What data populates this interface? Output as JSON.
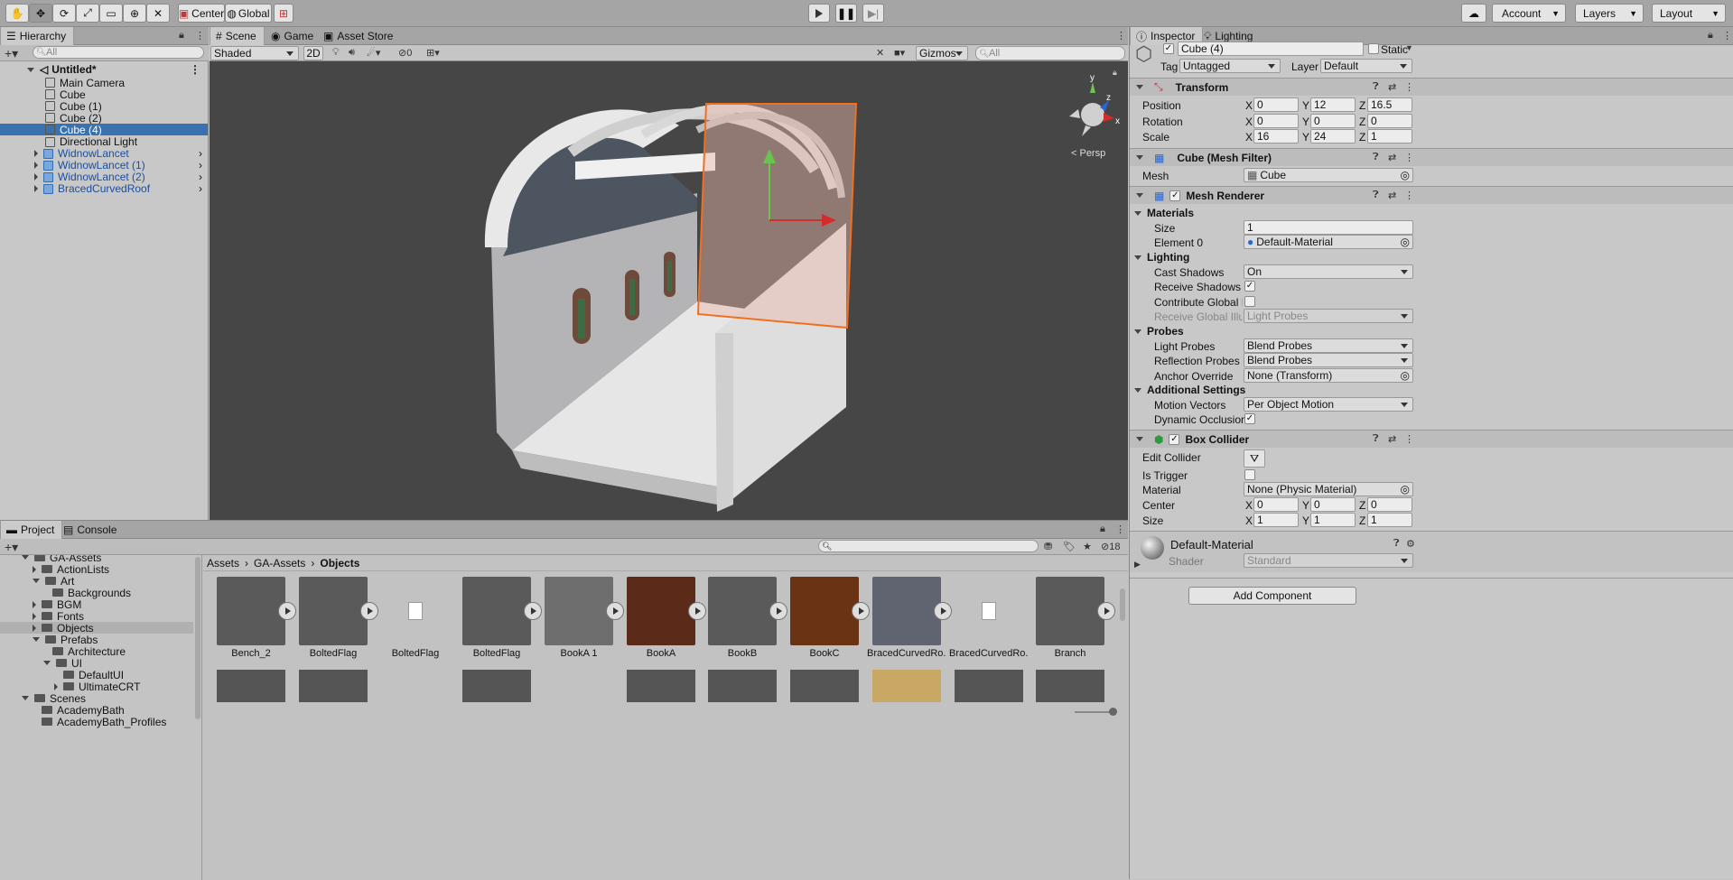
{
  "toolbar": {
    "pivot_label": "Center",
    "space_label": "Global",
    "account_label": "Account",
    "layers_label": "Layers",
    "layout_label": "Layout"
  },
  "hierarchy": {
    "tab_label": "Hierarchy",
    "search_placeholder": "All",
    "scene_name": "Untitled*",
    "items": [
      {
        "label": "Main Camera"
      },
      {
        "label": "Cube"
      },
      {
        "label": "Cube (1)"
      },
      {
        "label": "Cube (2)"
      },
      {
        "label": "Cube (4)"
      },
      {
        "label": "Directional Light"
      },
      {
        "label": "WidnowLancet"
      },
      {
        "label": "WidnowLancet (1)"
      },
      {
        "label": "WidnowLancet (2)"
      },
      {
        "label": "BracedCurvedRoof"
      }
    ]
  },
  "scene_view": {
    "tabs": [
      {
        "label": "Scene"
      },
      {
        "label": "Game"
      },
      {
        "label": "Asset Store"
      }
    ],
    "shading_mode": "Shaded",
    "mode_2d": "2D",
    "hidden_count": "0",
    "gizmos_label": "Gizmos",
    "search_placeholder": "All",
    "persp_label": "< Persp",
    "axis_y": "y",
    "axis_z": "z",
    "axis_x": "x"
  },
  "inspector": {
    "tabs": [
      {
        "label": "Inspector"
      },
      {
        "label": "Lighting"
      }
    ],
    "object_name": "Cube (4)",
    "static_label": "Static",
    "tag_label": "Tag",
    "tag_value": "Untagged",
    "layer_label": "Layer",
    "layer_value": "Default",
    "transform": {
      "title": "Transform",
      "position_label": "Position",
      "position": [
        "0",
        "12",
        "16.5"
      ],
      "rotation_label": "Rotation",
      "rotation": [
        "0",
        "0",
        "0"
      ],
      "scale_label": "Scale",
      "scale": [
        "16",
        "24",
        "1"
      ]
    },
    "mesh_filter": {
      "title": "Cube (Mesh Filter)",
      "mesh_label": "Mesh",
      "mesh_value": "Cube"
    },
    "mesh_renderer": {
      "title": "Mesh Renderer",
      "materials_label": "Materials",
      "size_label": "Size",
      "size_value": "1",
      "element_label": "Element 0",
      "element_value": "Default-Material",
      "lighting_label": "Lighting",
      "cast_shadows_label": "Cast Shadows",
      "cast_shadows_value": "On",
      "receive_shadows_label": "Receive Shadows",
      "contribute_gi_label": "Contribute Global Illun",
      "receive_gi_label": "Receive Global Illumi",
      "receive_gi_value": "Light Probes",
      "probes_label": "Probes",
      "light_probes_label": "Light Probes",
      "light_probes_value": "Blend Probes",
      "reflection_probes_label": "Reflection Probes",
      "reflection_probes_value": "Blend Probes",
      "anchor_override_label": "Anchor Override",
      "anchor_override_value": "None (Transform)",
      "additional_label": "Additional Settings",
      "motion_vectors_label": "Motion Vectors",
      "motion_vectors_value": "Per Object Motion",
      "dynamic_occlusion_label": "Dynamic Occlusion"
    },
    "box_collider": {
      "title": "Box Collider",
      "edit_collider_label": "Edit Collider",
      "is_trigger_label": "Is Trigger",
      "material_label": "Material",
      "material_value": "None (Physic Material)",
      "center_label": "Center",
      "center": [
        "0",
        "0",
        "0"
      ],
      "size_label": "Size",
      "size": [
        "1",
        "1",
        "1"
      ]
    },
    "material": {
      "name": "Default-Material",
      "shader_label": "Shader",
      "shader_value": "Standard"
    },
    "add_component_label": "Add Component"
  },
  "project": {
    "tabs": [
      {
        "label": "Project"
      },
      {
        "label": "Console"
      }
    ],
    "hidden_count": "18",
    "tree": [
      {
        "label": "GA-Assets",
        "indent": 1,
        "open": true
      },
      {
        "label": "ActionLists",
        "indent": 2,
        "open": false
      },
      {
        "label": "Art",
        "indent": 2,
        "open": true
      },
      {
        "label": "Backgrounds",
        "indent": 3,
        "open": null
      },
      {
        "label": "BGM",
        "indent": 2,
        "open": false
      },
      {
        "label": "Fonts",
        "indent": 2,
        "open": false
      },
      {
        "label": "Objects",
        "indent": 2,
        "open": false
      },
      {
        "label": "Prefabs",
        "indent": 2,
        "open": true
      },
      {
        "label": "Architecture",
        "indent": 3,
        "open": null
      },
      {
        "label": "UI",
        "indent": 3,
        "open": true
      },
      {
        "label": "DefaultUI",
        "indent": 4,
        "open": null
      },
      {
        "label": "UltimateCRT",
        "indent": 4,
        "open": false
      },
      {
        "label": "Scenes",
        "indent": 1,
        "open": true
      },
      {
        "label": "AcademyBath",
        "indent": 2,
        "open": null
      },
      {
        "label": "AcademyBath_Profiles",
        "indent": 2,
        "open": null
      }
    ],
    "breadcrumb": [
      "Assets",
      "GA-Assets",
      "Objects"
    ],
    "assets": [
      {
        "name": "Bench_2",
        "color": "#5a5a5a",
        "play": true
      },
      {
        "name": "BoltedFlag",
        "color": "#5a5a5a",
        "play": true
      },
      {
        "name": "BoltedFlag",
        "color": "none",
        "play": false
      },
      {
        "name": "BoltedFlag",
        "color": "#5a5a5a",
        "play": true
      },
      {
        "name": "BookA 1",
        "color": "#6e6e6e",
        "play": true
      },
      {
        "name": "BookA",
        "color": "#5b2a18",
        "play": true
      },
      {
        "name": "BookB",
        "color": "#5a5a5a",
        "play": true
      },
      {
        "name": "BookC",
        "color": "#6a3414",
        "play": true
      },
      {
        "name": "BracedCurvedRo...",
        "color": "#5f6470",
        "play": true
      },
      {
        "name": "BracedCurvedRo...",
        "color": "none",
        "play": false
      },
      {
        "name": "Branch",
        "color": "#5a5a5a",
        "play": true
      }
    ]
  }
}
